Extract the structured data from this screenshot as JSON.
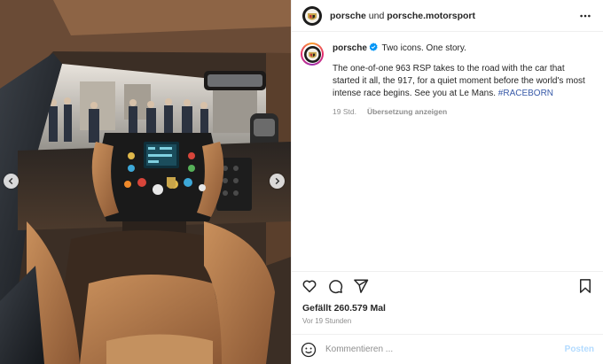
{
  "header": {
    "author_primary": "porsche",
    "connector": "und",
    "author_secondary": "porsche.motorsport",
    "more_icon": "more-horizontal-icon"
  },
  "caption": {
    "username": "porsche",
    "verified_icon": "verified-badge-icon",
    "headline": "Two icons. One story.",
    "body": "The one-of-one 963 RSP takes to the road with the car that started it all, the 917, for a quiet moment before the world's most intense race begins. See you at Le Mans.",
    "hashtag": "#RACEBORN",
    "time": "19 Std.",
    "translate": "Übersetzung anzeigen"
  },
  "actions": {
    "like_icon": "heart-icon",
    "comment_icon": "comment-icon",
    "share_icon": "paper-plane-icon",
    "save_icon": "bookmark-icon"
  },
  "likes": "Gefällt 260.579 Mal",
  "posted_ago": "Vor 19 Stunden",
  "comment": {
    "emoji_icon": "smiley-icon",
    "placeholder": "Kommentieren ...",
    "post_label": "Posten"
  },
  "media": {
    "prev_icon": "chevron-left-icon",
    "next_icon": "chevron-right-icon"
  },
  "colors": {
    "hashtag": "#385aa8",
    "verified": "#0095f6",
    "post_button": "#b3dbff",
    "leather": "#b07a4e"
  }
}
